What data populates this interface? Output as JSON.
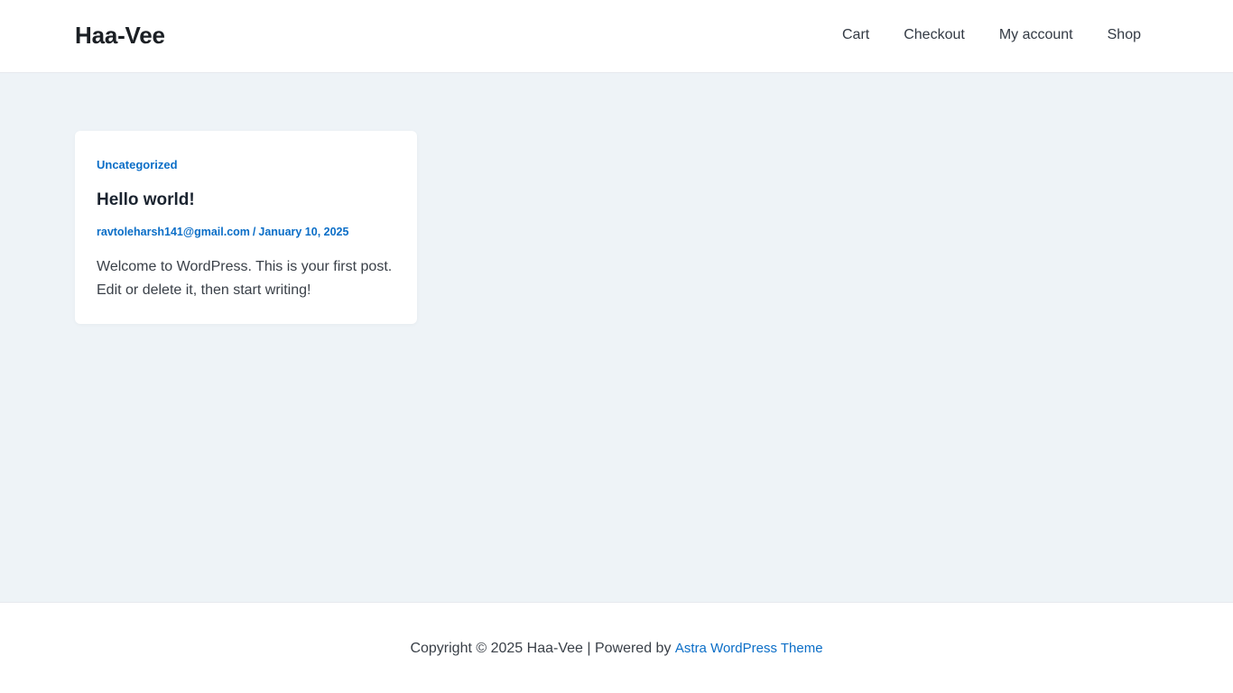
{
  "header": {
    "site_title": "Haa-Vee",
    "nav": [
      "Cart",
      "Checkout",
      "My account",
      "Shop"
    ]
  },
  "post": {
    "category": "Uncategorized",
    "title": "Hello world!",
    "author": "ravtoleharsh141@gmail.com",
    "separator": "/",
    "date": "January 10, 2025",
    "excerpt": "Welcome to WordPress. This is your first post. Edit or delete it, then start writing!"
  },
  "footer": {
    "copyright_text": "Copyright © 2025 Haa-Vee | Powered by",
    "theme_link": "Astra WordPress Theme"
  },
  "colors": {
    "accent": "#0b6ec7",
    "background": "#eef3f7",
    "surface": "#ffffff"
  }
}
